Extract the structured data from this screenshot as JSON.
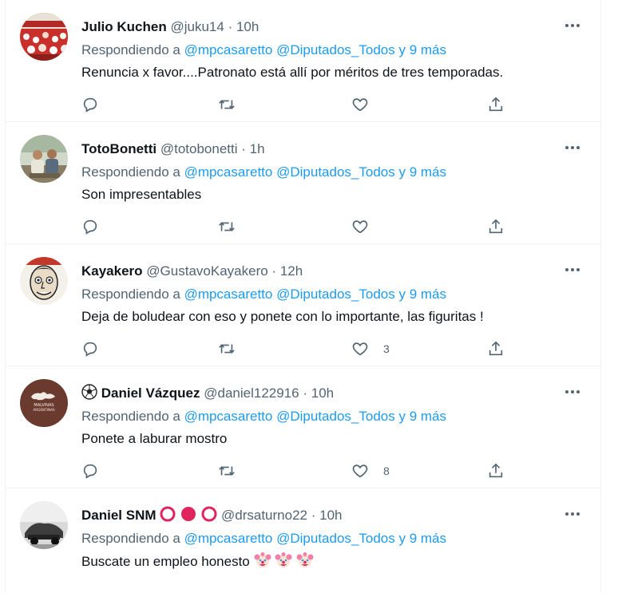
{
  "tweets": [
    {
      "name": "Julio Kuchen",
      "handle": "@juku14",
      "time": "10h",
      "replying_prefix": "Respondiendo a",
      "mention_1": "@mpcasaretto",
      "mention_2": "@Diputados_Todos",
      "mention_more": "y 9 más",
      "text": "Renuncia x favor....Patronato está allí por méritos de tres temporadas.",
      "likes": "",
      "avatar": "stadium-crowd-avatar"
    },
    {
      "name": "TotoBonetti",
      "handle": "@totobonetti",
      "time": "1h",
      "replying_prefix": "Respondiendo a",
      "mention_1": "@mpcasaretto",
      "mention_2": "@Diputados_Todos",
      "mention_more": "y 9 más",
      "text": "Son impresentables",
      "likes": "",
      "avatar": "two-people-avatar"
    },
    {
      "name": "Kayakero",
      "handle": "@GustavoKayakero",
      "time": "12h",
      "replying_prefix": "Respondiendo a",
      "mention_1": "@mpcasaretto",
      "mention_2": "@Diputados_Todos",
      "mention_more": "y 9 más",
      "text": "Deja de boludear con eso y ponete con lo importante, las figuritas !",
      "likes": "3",
      "avatar": "caricature-face-avatar"
    },
    {
      "name": "Daniel Vázquez",
      "name_emoji": "soccer-ball-icon",
      "handle": "@daniel122916",
      "time": "10h",
      "replying_prefix": "Respondiendo a",
      "mention_1": "@mpcasaretto",
      "mention_2": "@Diputados_Todos",
      "mention_more": "y 9 más",
      "text": "Ponete a laburar mostro",
      "likes": "8",
      "avatar": "malvinas-map-avatar",
      "avatar_text_1": "MALVINAS",
      "avatar_text_2": "ARGENTINAS"
    },
    {
      "name": "Daniel SNM",
      "name_emoji": "circles-icon",
      "handle": "@drsaturno22",
      "time": "10h",
      "replying_prefix": "Respondiendo a",
      "mention_1": "@mpcasaretto",
      "mention_2": "@Diputados_Todos",
      "mention_more": "y 9 más",
      "text": "Buscate un empleo honesto",
      "text_emoji": "clown-face-icon x3",
      "likes": "",
      "avatar": "bw-photo-avatar"
    }
  ],
  "dot_sep": "·",
  "colors": {
    "accent": "#1d9bf0",
    "secondary_text": "#536471",
    "primary_text": "#0f1419",
    "border": "#eff3f4",
    "red": "#e0245e"
  }
}
